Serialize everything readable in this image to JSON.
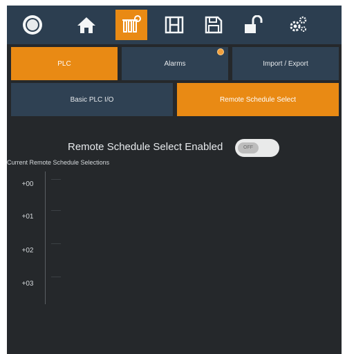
{
  "toolbar": {
    "icons": [
      "power-icon",
      "home-icon",
      "plc-io-icon",
      "film-icon",
      "save-icon",
      "unlock-icon",
      "settings-gears-icon"
    ],
    "active_icon": "plc-io-icon",
    "accent": "#e98a14",
    "bar_color": "#2c3e50"
  },
  "tabs": [
    {
      "label": "PLC",
      "active": true
    },
    {
      "label": "Alarms",
      "active": false,
      "badge": true
    },
    {
      "label": "Import / Export",
      "active": false
    }
  ],
  "subtabs": [
    {
      "label": "Basic PLC I/O",
      "active": false
    },
    {
      "label": "Remote Schedule Select",
      "active": true
    }
  ],
  "remote_schedule": {
    "enabled_label": "Remote Schedule Select Enabled",
    "toggle_text": "OFF",
    "selections_label": "Current Remote Schedule Selections",
    "rows": [
      "+00",
      "+01",
      "+02",
      "+03"
    ]
  }
}
